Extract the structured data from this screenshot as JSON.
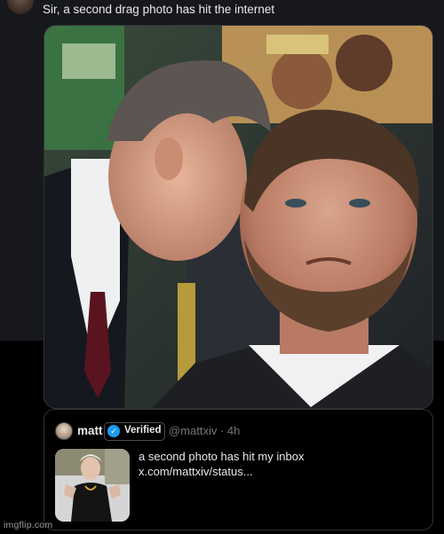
{
  "tweet": {
    "text": "Sir, a second drag photo has hit the internet"
  },
  "quote": {
    "name": "matt",
    "verified_label": "Verified",
    "handle_time": "@mattxiv · 4h",
    "line1": "a second photo has hit my inbox",
    "line2": "x.com/mattxiv/status..."
  },
  "watermark": "imgflip.com",
  "colors": {
    "background": "#000000",
    "tweet_panel": "#16181c",
    "text": "#e7e9ea",
    "muted": "#71767b",
    "verified_blue": "#1d9bf0"
  },
  "icons": {
    "verified": "verified-check-icon"
  }
}
